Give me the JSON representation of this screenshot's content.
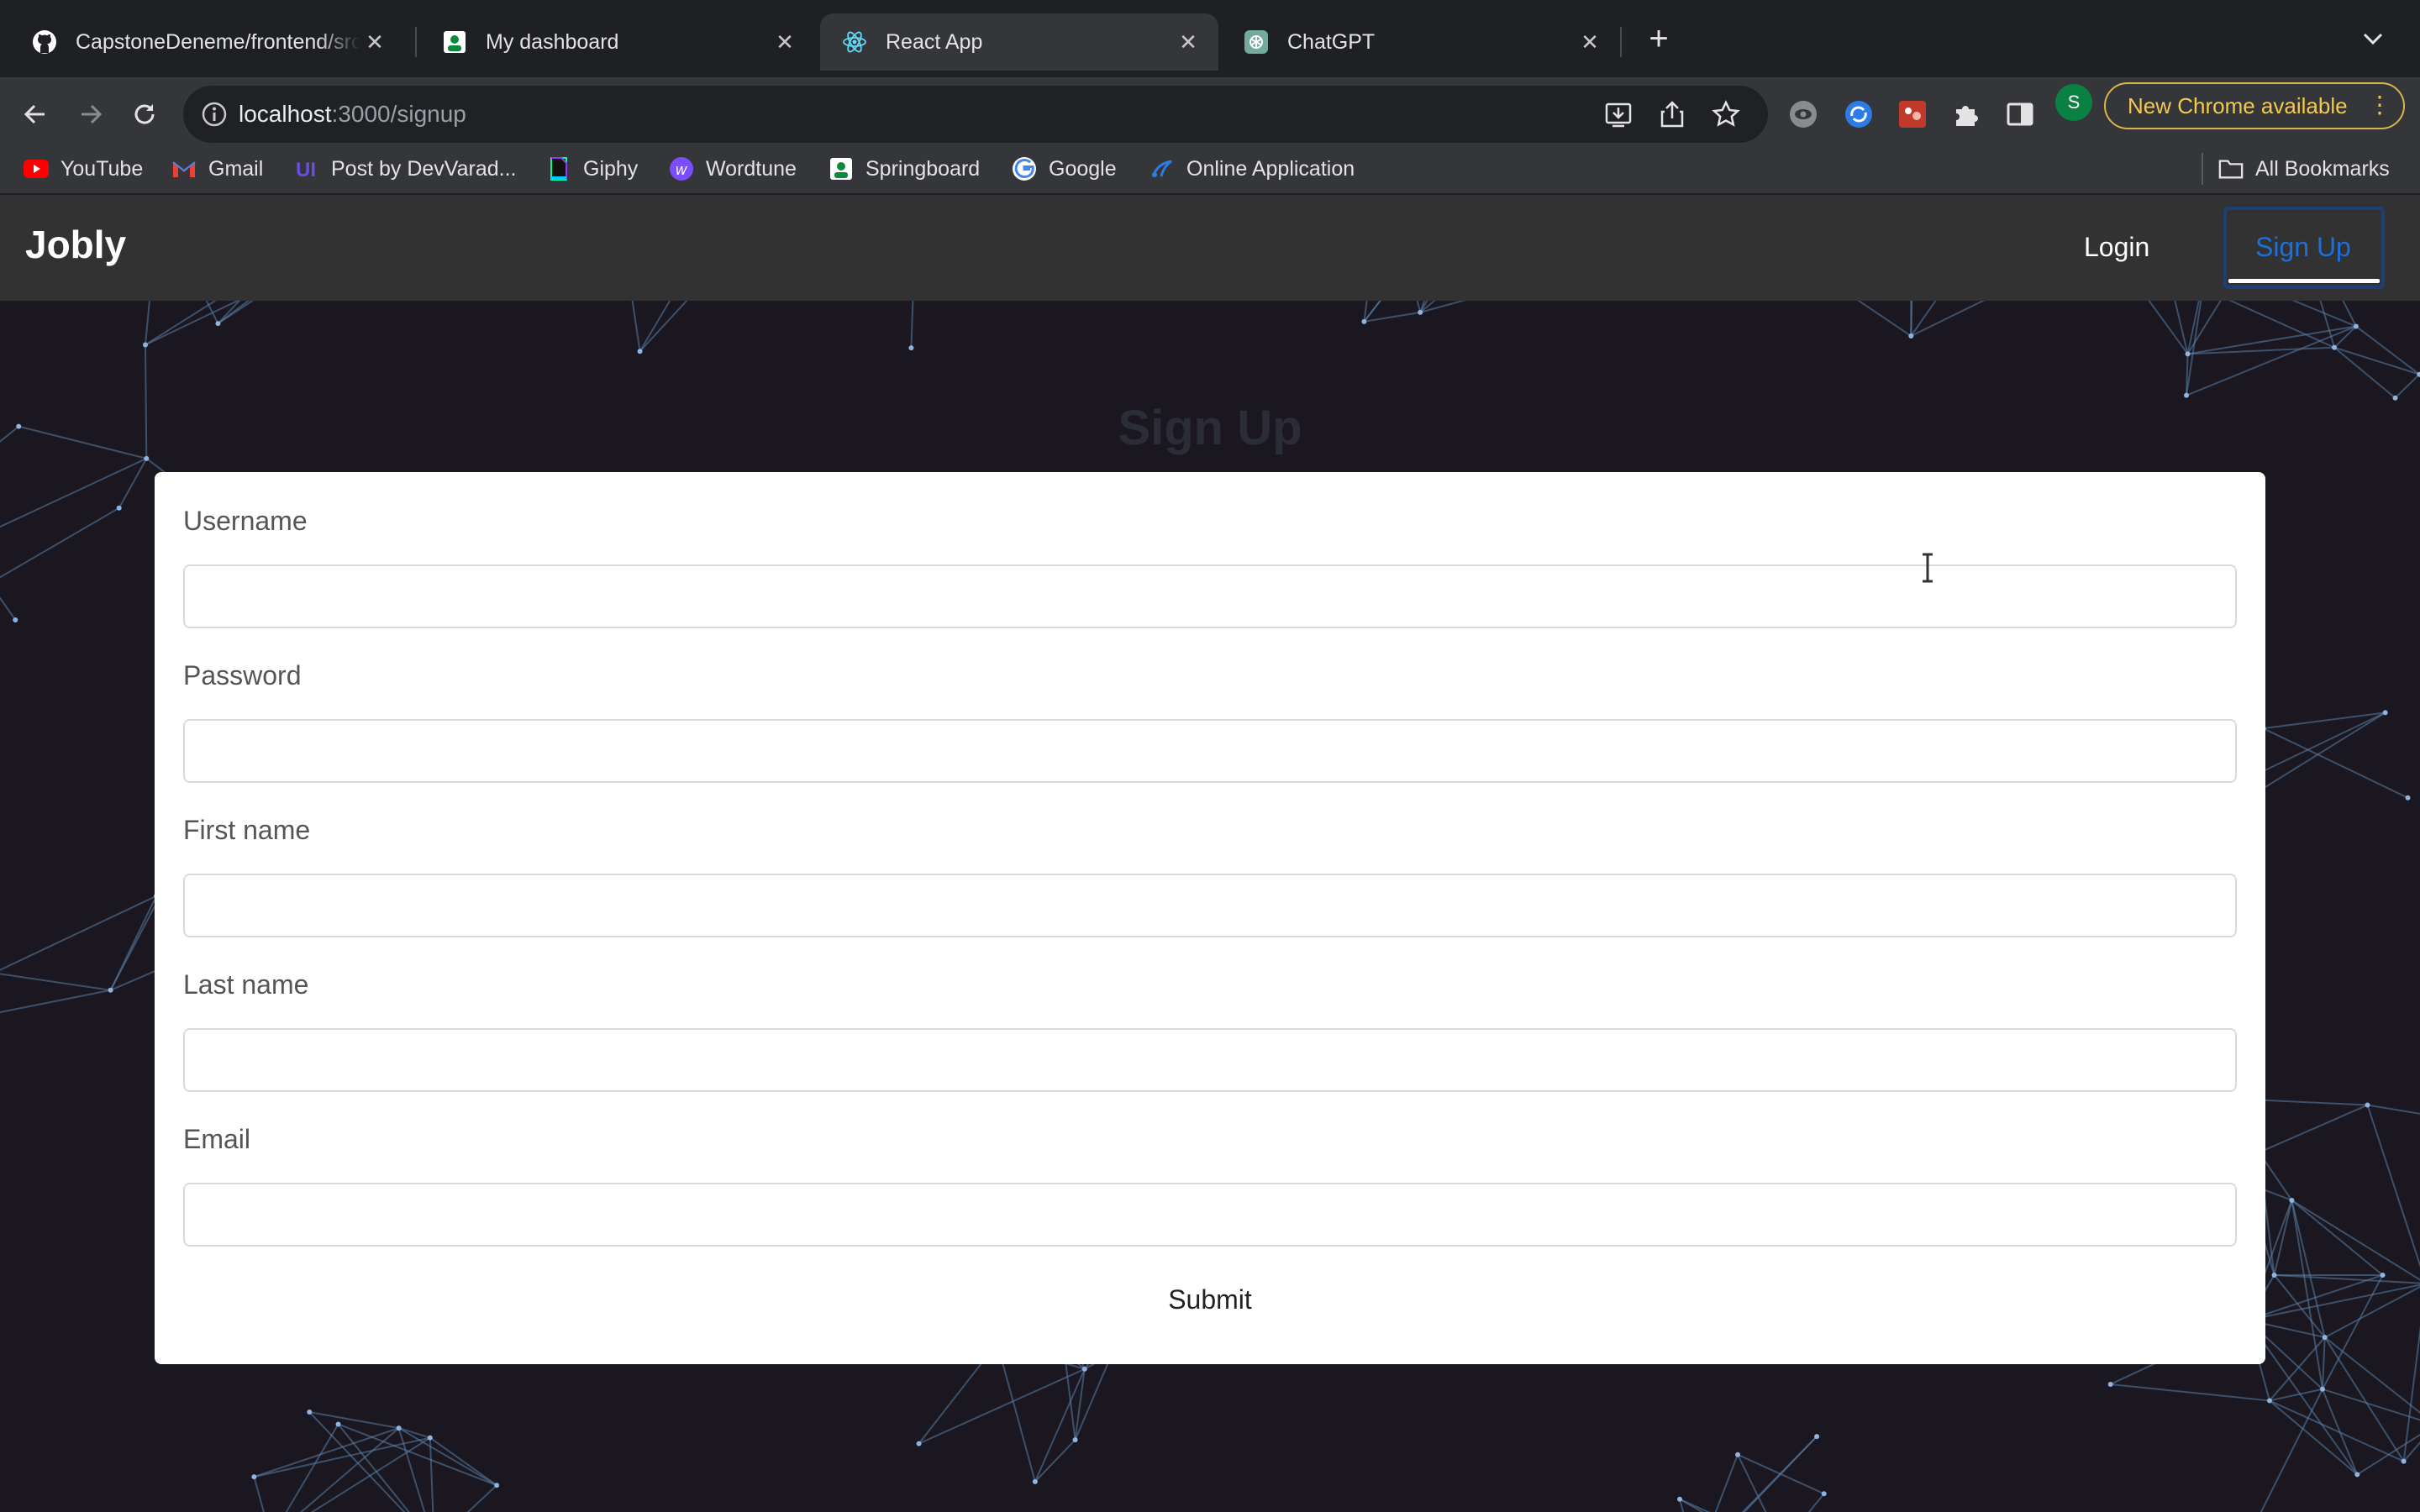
{
  "browser": {
    "tabs": [
      {
        "title": "CapstoneDeneme/frontend/src",
        "icon": "github-icon"
      },
      {
        "title": "My dashboard",
        "icon": "springboard-icon"
      },
      {
        "title": "React App",
        "icon": "react-icon",
        "active": true
      },
      {
        "title": "ChatGPT",
        "icon": "chatgpt-icon"
      }
    ],
    "url_host": "localhost",
    "url_rest": ":3000/signup",
    "update_button": "New Chrome available",
    "profile_initial": "S",
    "bookmarks": [
      {
        "label": "YouTube",
        "icon": "youtube-icon"
      },
      {
        "label": "Gmail",
        "icon": "gmail-icon"
      },
      {
        "label": "Post by DevVarad...",
        "icon": "ui-icon"
      },
      {
        "label": "Giphy",
        "icon": "giphy-icon"
      },
      {
        "label": "Wordtune",
        "icon": "wordtune-icon"
      },
      {
        "label": "Springboard",
        "icon": "springboard-icon"
      },
      {
        "label": "Google",
        "icon": "google-icon"
      },
      {
        "label": "Online Application",
        "icon": "application-icon"
      }
    ],
    "all_bookmarks": "All Bookmarks"
  },
  "app": {
    "brand": "Jobly",
    "nav": {
      "login": "Login",
      "signup": "Sign Up"
    },
    "heading": "Sign Up",
    "form": {
      "fields": [
        {
          "label": "Username",
          "value": ""
        },
        {
          "label": "Password",
          "value": ""
        },
        {
          "label": "First name",
          "value": ""
        },
        {
          "label": "Last name",
          "value": ""
        },
        {
          "label": "Email",
          "value": ""
        }
      ],
      "submit": "Submit"
    }
  },
  "colors": {
    "page_bg": "#1a1720",
    "navbar_bg": "#323232",
    "accent": "#1d6fdb",
    "chrome_update": "#f3c94f"
  }
}
